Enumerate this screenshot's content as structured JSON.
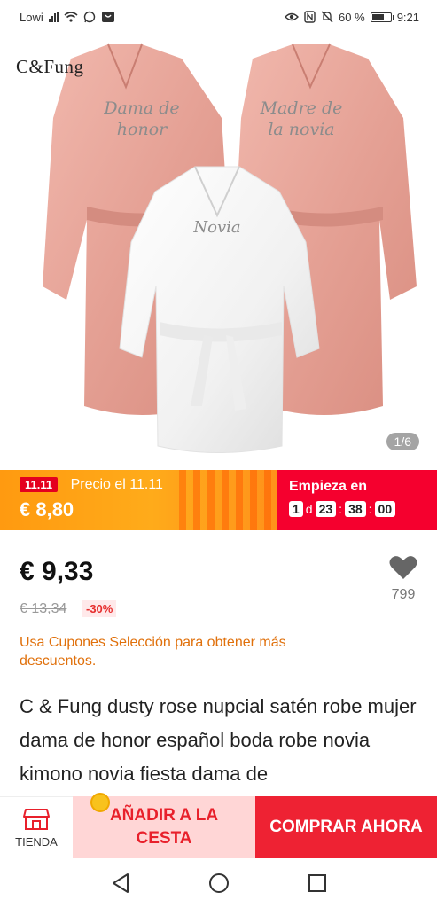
{
  "status_bar": {
    "carrier": "Lowi",
    "battery": "60 %",
    "time": "9:21"
  },
  "header": {
    "brand": "C&Fung",
    "icons": [
      "cart-icon",
      "share-icon",
      "more-icon"
    ]
  },
  "gallery": {
    "counter": "1/6",
    "robe_labels": [
      "Dama de honor",
      "Madre de la novia",
      "Novia"
    ]
  },
  "promo": {
    "tag": "11.11",
    "date_label": "Precio el 11.11",
    "price": "€ 8,80",
    "starts_label": "Empieza en",
    "countdown": {
      "days": "1",
      "days_unit": "d",
      "hours": "23",
      "minutes": "38",
      "seconds": "00"
    }
  },
  "product": {
    "price": "€ 9,33",
    "original_price": "€ 13,34",
    "discount": "-30%",
    "wishlist_count": "799",
    "coupon_note": "Usa Cupones Selección para obtener más descuentos.",
    "title": "C & Fung dusty rose nupcial satén robe mujer dama de honor español boda robe novia kimono novia fiesta dama de"
  },
  "actions": {
    "store_label": "TIENDA",
    "add_to_cart": "AÑADIR A LA CESTA",
    "buy_now": "COMPRAR AHORA"
  },
  "colors": {
    "promo_orange": "#ffa31a",
    "promo_red": "#f5002e",
    "buy_red": "#ee2233",
    "cart_pink": "#ffd6d6",
    "coupon_orange": "#e0700b",
    "robe_pink": "#e8a79b"
  }
}
